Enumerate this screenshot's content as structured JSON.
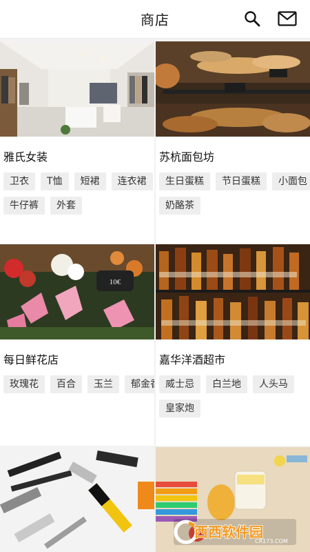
{
  "header": {
    "title": "商店",
    "search_icon": "search-icon",
    "mail_icon": "mail-icon"
  },
  "stores": [
    {
      "name": "雅氏女装",
      "tags": [
        "卫衣",
        "T恤",
        "短裙",
        "连衣裙",
        "牛仔裤",
        "外套"
      ]
    },
    {
      "name": "苏杭面包坊",
      "tags": [
        "生日蛋糕",
        "节日蛋糕",
        "小面包",
        "奶酪茶"
      ]
    },
    {
      "name": "每日鲜花店",
      "tags": [
        "玫瑰花",
        "百合",
        "玉兰",
        "郁金香"
      ]
    },
    {
      "name": "嘉华洋酒超市",
      "tags": [
        "威士忌",
        "白兰地",
        "人头马",
        "皇家炮"
      ]
    },
    {
      "name": "",
      "tags": []
    },
    {
      "name": "",
      "tags": []
    }
  ],
  "watermark": {
    "brand": "西西软件园",
    "url": "CR173.COM"
  },
  "colors": {
    "background": "#f2f2f2",
    "card": "#ffffff",
    "tag_bg": "#eeeeee",
    "watermark_orange": "#f39a1e"
  }
}
